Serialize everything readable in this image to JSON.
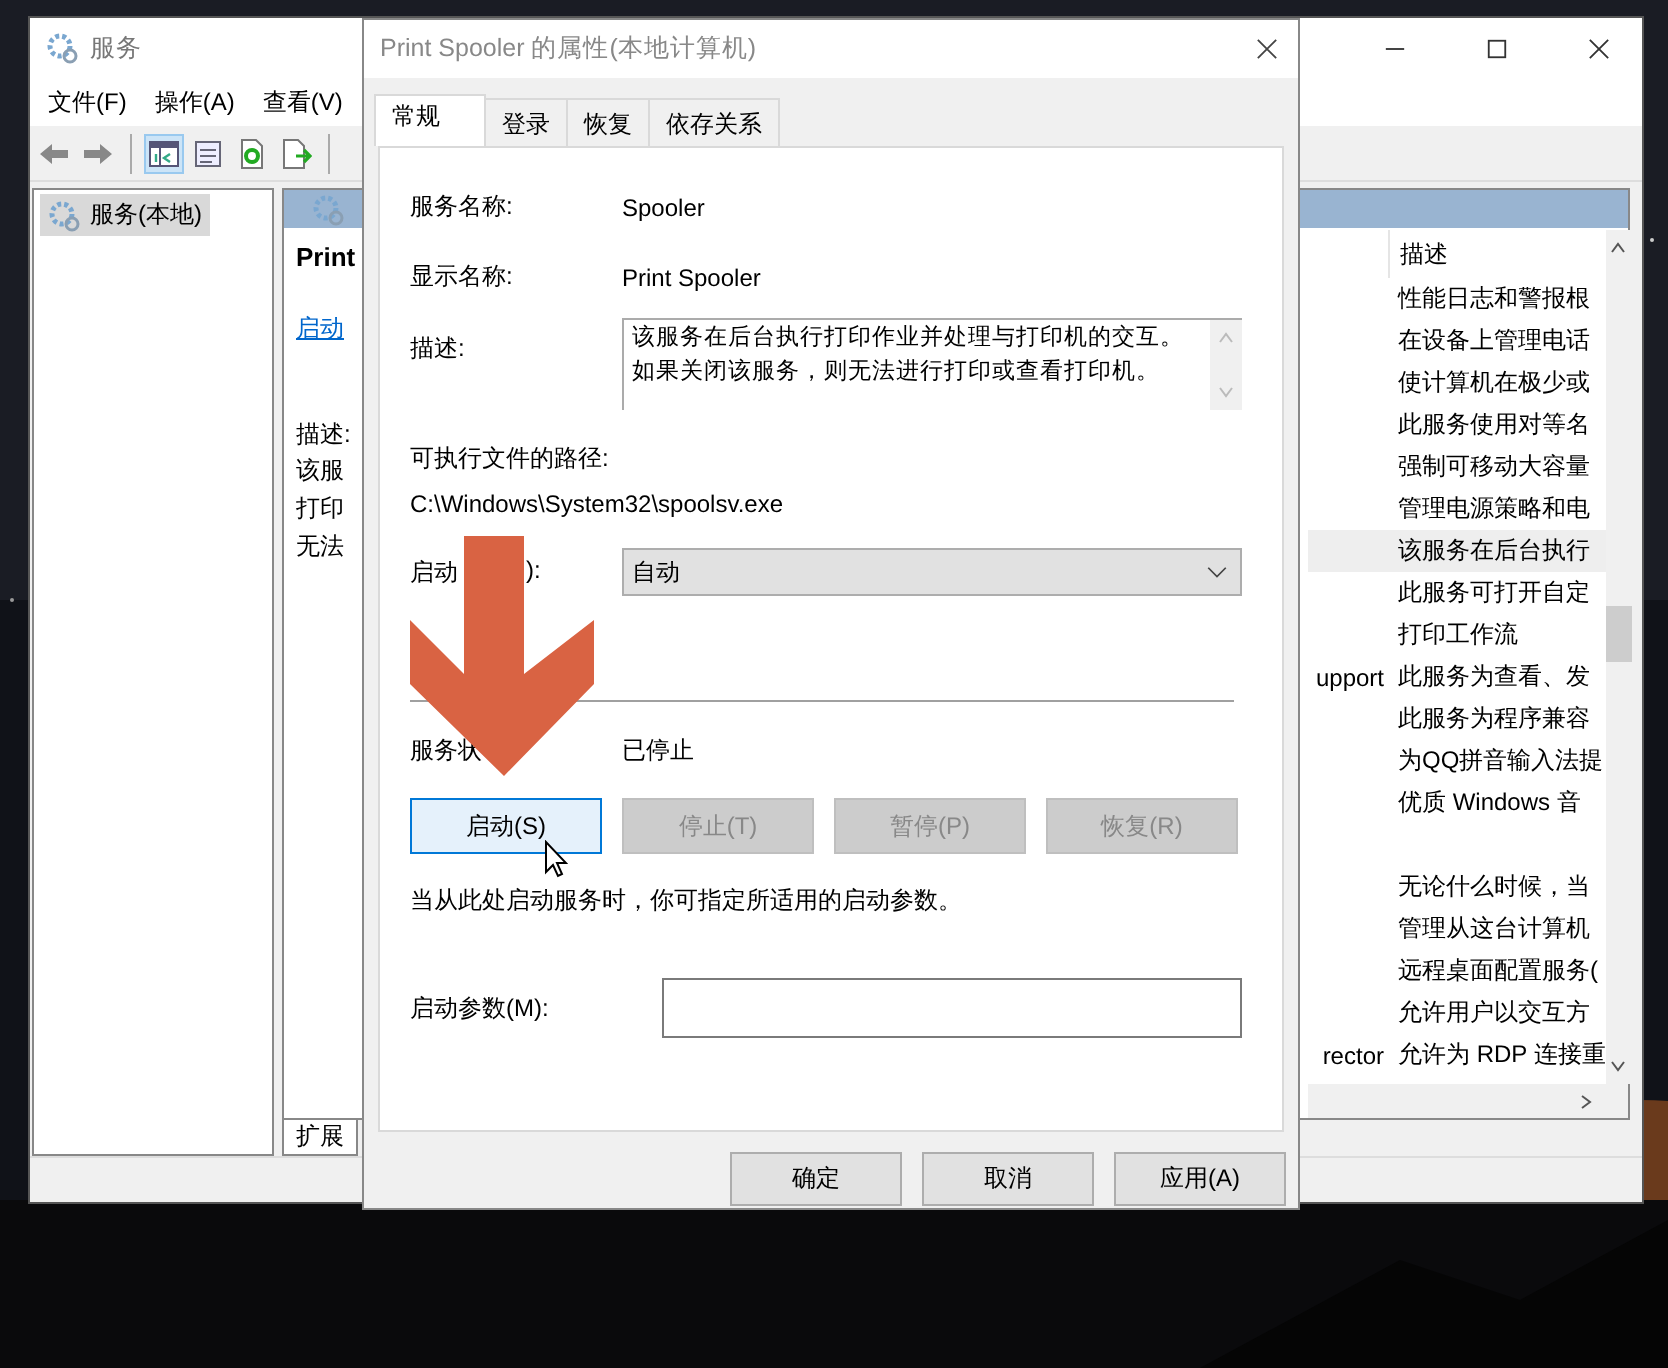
{
  "services_window": {
    "title": "服务",
    "menu": [
      "文件(F)",
      "操作(A)",
      "查看(V)"
    ],
    "toolbar": [
      {
        "kind": "back",
        "selected": false
      },
      {
        "kind": "forward",
        "selected": false
      },
      {
        "kind": "pane",
        "selected": true
      },
      {
        "kind": "properties",
        "selected": false
      },
      {
        "kind": "refresh",
        "selected": false
      },
      {
        "kind": "export",
        "selected": false
      }
    ],
    "tree": [
      {
        "label": "服务(本地)",
        "selected": true
      }
    ],
    "extended": {
      "title": "Print",
      "link": "启动",
      "description_label": "描述:",
      "description_lines": [
        "该服",
        "打印",
        "无法"
      ]
    },
    "list": {
      "column_2_header": "描述",
      "rows": [
        {
          "description": "性能日志和警报根",
          "selected": false
        },
        {
          "description": "在设备上管理电话",
          "selected": false
        },
        {
          "description": "使计算机在极少或",
          "selected": false
        },
        {
          "description": "此服务使用对等名",
          "selected": false
        },
        {
          "description": "强制可移动大容量",
          "selected": false
        },
        {
          "description": "管理电源策略和电",
          "selected": false
        },
        {
          "description": "该服务在后台执行",
          "selected": true
        },
        {
          "description": "此服务可打开自定",
          "selected": false
        },
        {
          "description": "打印工作流",
          "selected": false
        },
        {
          "column_1": "upport",
          "description": "此服务为查看、发",
          "selected": false
        },
        {
          "description": "此服务为程序兼容",
          "selected": false
        },
        {
          "description": "为QQ拼音输入法提",
          "selected": false
        },
        {
          "description": "优质 Windows 音",
          "selected": false
        },
        {},
        {
          "description": "无论什么时候，当",
          "selected": false
        },
        {
          "description": "管理从这台计算机",
          "selected": false
        },
        {
          "description": "远程桌面配置服务(",
          "selected": false
        },
        {
          "description": "允许用户以交互方",
          "selected": false
        },
        {
          "column_1": "rector",
          "description": "允许为 RDP 连接重",
          "selected": false
        }
      ]
    },
    "view_tabs": [
      {
        "label": "扩展",
        "selected": true
      }
    ]
  },
  "dialog": {
    "title": "Print Spooler 的属性(本地计算机)",
    "tabs": [
      {
        "label": "常规",
        "selected": true
      },
      {
        "label": "登录",
        "selected": false
      },
      {
        "label": "恢复",
        "selected": false
      },
      {
        "label": "依存关系",
        "selected": false
      }
    ],
    "service_name": {
      "label": "服务名称:",
      "value": "Spooler"
    },
    "display_name": {
      "label": "显示名称:",
      "value": "Print Spooler"
    },
    "description": {
      "label": "描述:",
      "value": "该服务在后台执行打印作业并处理与打印机的交互。如果关闭该服务，则无法进行打印或查看打印机。"
    },
    "path": {
      "label": "可执行文件的路径:",
      "value": "C:\\Windows\\System32\\spoolsv.exe"
    },
    "startup_type": {
      "label": "启动",
      "label_tail": "):",
      "value": "自动"
    },
    "status": {
      "label": "服务状",
      "value": "已停止"
    },
    "control_buttons": [
      {
        "label": "启动(S)",
        "disabled": false,
        "hovered": true
      },
      {
        "label": "停止(T)",
        "disabled": true,
        "hovered": false
      },
      {
        "label": "暂停(P)",
        "disabled": true,
        "hovered": false
      },
      {
        "label": "恢复(R)",
        "disabled": true,
        "hovered": false
      }
    ],
    "hint": "当从此处启动服务时，你可指定所适用的启动参数。",
    "start_parameters": {
      "label": "启动参数(M):"
    },
    "buttons": [
      "确定",
      "取消",
      "应用(A)"
    ]
  }
}
